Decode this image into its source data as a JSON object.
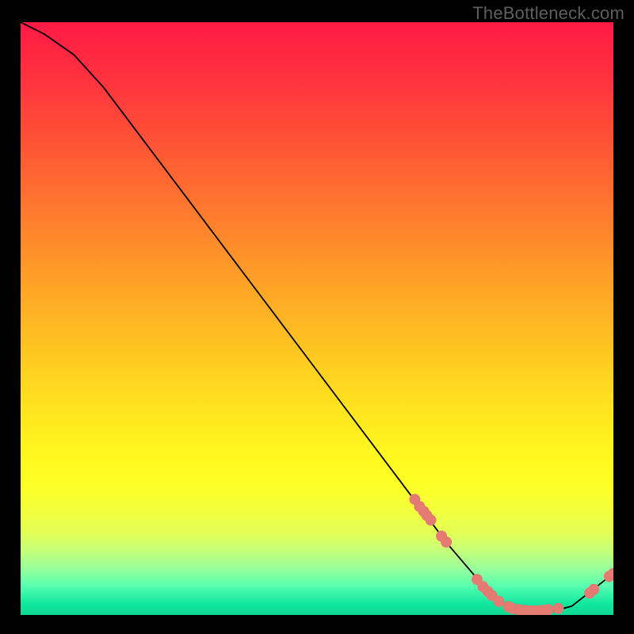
{
  "watermark": "TheBottleneck.com",
  "chart_data": {
    "type": "line",
    "title": "",
    "xlabel": "",
    "ylabel": "",
    "xlim": [
      0,
      100
    ],
    "ylim": [
      0,
      100
    ],
    "curve": [
      {
        "x": 0,
        "y": 100
      },
      {
        "x": 4,
        "y": 98
      },
      {
        "x": 9,
        "y": 94.5
      },
      {
        "x": 14,
        "y": 89
      },
      {
        "x": 72,
        "y": 12
      },
      {
        "x": 78,
        "y": 5
      },
      {
        "x": 82,
        "y": 1.5
      },
      {
        "x": 85,
        "y": 0.7
      },
      {
        "x": 90,
        "y": 0.7
      },
      {
        "x": 93,
        "y": 1.5
      },
      {
        "x": 100,
        "y": 7
      }
    ],
    "points": [
      {
        "x": 66.5,
        "y": 19.5
      },
      {
        "x": 67.3,
        "y": 18.3
      },
      {
        "x": 68.0,
        "y": 17.5
      },
      {
        "x": 68.5,
        "y": 16.8
      },
      {
        "x": 69.2,
        "y": 16.0
      },
      {
        "x": 71.0,
        "y": 13.3
      },
      {
        "x": 71.8,
        "y": 12.3
      },
      {
        "x": 77.0,
        "y": 6.0
      },
      {
        "x": 78.0,
        "y": 4.8
      },
      {
        "x": 78.8,
        "y": 4.0
      },
      {
        "x": 79.5,
        "y": 3.3
      },
      {
        "x": 80.7,
        "y": 2.3
      },
      {
        "x": 82.3,
        "y": 1.4
      },
      {
        "x": 83.0,
        "y": 1.1
      },
      {
        "x": 84.0,
        "y": 0.9
      },
      {
        "x": 85.0,
        "y": 0.8
      },
      {
        "x": 86.0,
        "y": 0.7
      },
      {
        "x": 86.8,
        "y": 0.7
      },
      {
        "x": 87.5,
        "y": 0.7
      },
      {
        "x": 88.3,
        "y": 0.8
      },
      {
        "x": 89.0,
        "y": 0.9
      },
      {
        "x": 90.7,
        "y": 1.1
      },
      {
        "x": 96.0,
        "y": 3.7
      },
      {
        "x": 96.7,
        "y": 4.3
      },
      {
        "x": 99.3,
        "y": 6.5
      },
      {
        "x": 100.0,
        "y": 7.0
      }
    ],
    "point_color": "#e37b72",
    "point_radius": 7,
    "curve_color": "#000000"
  }
}
